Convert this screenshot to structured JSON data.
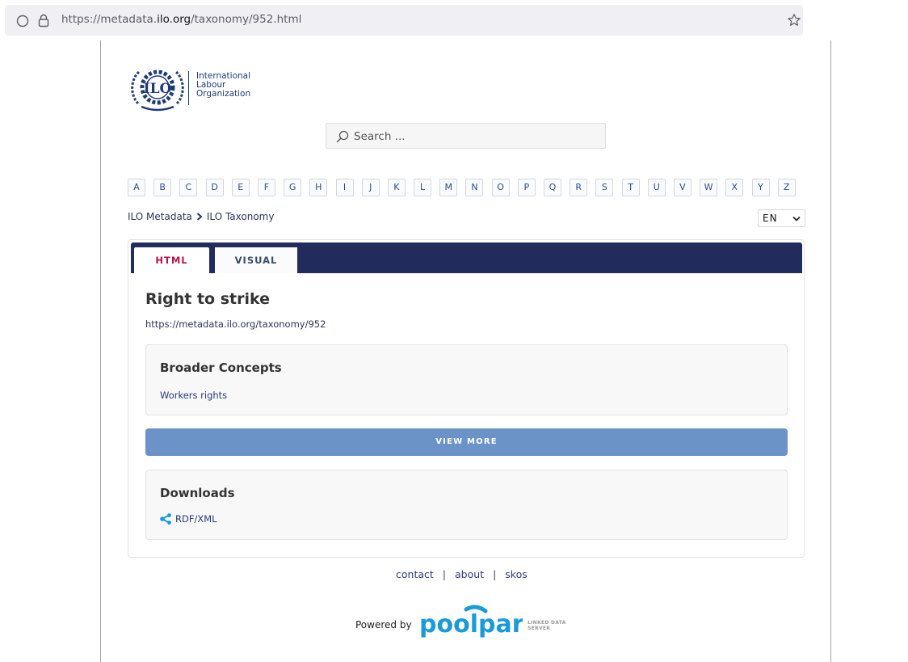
{
  "browser": {
    "url_prefix": "https://metadata.",
    "url_domain": "ilo.org",
    "url_path": "/taxonomy/952.html"
  },
  "org": {
    "line1": "International",
    "line2": "Labour",
    "line3": "Organization"
  },
  "search": {
    "placeholder": "Search ..."
  },
  "alphabet": [
    "A",
    "B",
    "C",
    "D",
    "E",
    "F",
    "G",
    "H",
    "I",
    "J",
    "K",
    "L",
    "M",
    "N",
    "O",
    "P",
    "Q",
    "R",
    "S",
    "T",
    "U",
    "V",
    "W",
    "X",
    "Y",
    "Z"
  ],
  "breadcrumb": {
    "root": "ILO Metadata",
    "current": "ILO Taxonomy"
  },
  "language": {
    "selected": "EN"
  },
  "tabs": {
    "html": "HTML",
    "visual": "VISUAL"
  },
  "concept": {
    "title": "Right to strike",
    "uri": "https://metadata.ilo.org/taxonomy/952"
  },
  "broader": {
    "title": "Broader Concepts",
    "item": "Workers rights"
  },
  "view_more": "VIEW MORE",
  "downloads": {
    "title": "Downloads",
    "rdf": "RDF/XML"
  },
  "footer": {
    "contact": "contact",
    "about": "about",
    "skos": "skos",
    "separator": "|",
    "powered_by": "Powered by",
    "brand": "poolparty",
    "brand_tag": "LINKED DATA SERVER"
  },
  "colors": {
    "navy": "#222c5c",
    "accent_pink": "#b0154c",
    "button_blue": "#6b93c7",
    "pp_blue": "#1a9ad6"
  }
}
